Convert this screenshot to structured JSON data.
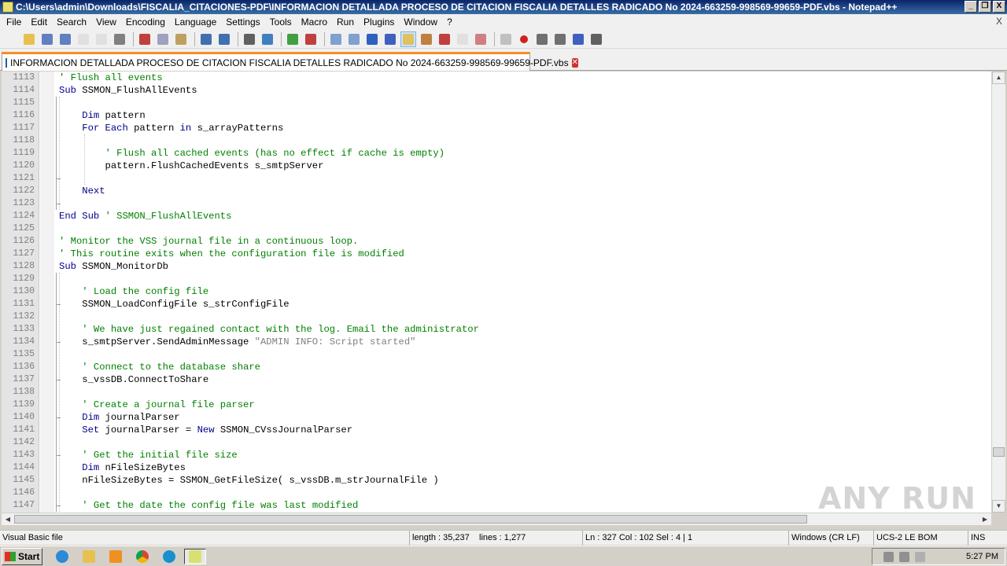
{
  "window": {
    "title": "C:\\Users\\admin\\Downloads\\FISCALIA_CITACIONES-PDF\\INFORMACION DETALLADA PROCESO DE CITACION FISCALIA DETALLES RADICADO No 2024-663259-998569-99659-PDF.vbs - Notepad++",
    "minimize": "_",
    "restore": "❐",
    "close": "X"
  },
  "menu": {
    "items": [
      "File",
      "Edit",
      "Search",
      "View",
      "Encoding",
      "Language",
      "Settings",
      "Tools",
      "Macro",
      "Run",
      "Plugins",
      "Window",
      "?"
    ],
    "close_glyph": "X"
  },
  "toolbar": {
    "icons": [
      "new-file-icon",
      "open-file-icon",
      "save-icon",
      "save-all-icon",
      "close-icon",
      "close-all-icon",
      "print-icon",
      "cut-icon",
      "copy-icon",
      "paste-icon",
      "undo-icon",
      "redo-icon",
      "find-icon",
      "replace-icon",
      "zoom-in-icon",
      "zoom-out-icon",
      "sync-vertical-icon",
      "sync-horizontal-icon",
      "word-wrap-icon",
      "show-all-chars-icon",
      "indent-guide-icon",
      "user-lang-icon",
      "doc-map-icon",
      "function-list-icon",
      "folder-workspace-icon",
      "monitoring-icon",
      "record-macro-icon",
      "stop-macro-icon",
      "play-macro-icon",
      "run-macro-multiple-icon",
      "save-macro-icon"
    ]
  },
  "tab": {
    "label": "INFORMACION DETALLADA PROCESO DE CITACION FISCALIA DETALLES RADICADO No 2024-663259-998569-99659-PDF.vbs",
    "close_glyph": "✕"
  },
  "editor": {
    "lines": [
      {
        "n": "1113",
        "segments": [
          {
            "t": "' Flush all events",
            "c": "cm"
          }
        ]
      },
      {
        "n": "1114",
        "segments": [
          {
            "t": "Sub",
            "c": "kw"
          },
          {
            "t": " SSMON_FlushAllEvents",
            "c": "tx"
          }
        ]
      },
      {
        "n": "1115",
        "segments": []
      },
      {
        "n": "1116",
        "segments": [
          {
            "t": "    ",
            "c": "tx"
          },
          {
            "t": "Dim",
            "c": "kw"
          },
          {
            "t": " pattern",
            "c": "tx"
          }
        ]
      },
      {
        "n": "1117",
        "segments": [
          {
            "t": "    ",
            "c": "tx"
          },
          {
            "t": "For Each",
            "c": "kw"
          },
          {
            "t": " pattern ",
            "c": "tx"
          },
          {
            "t": "in",
            "c": "kw"
          },
          {
            "t": " s_arrayPatterns",
            "c": "tx"
          }
        ]
      },
      {
        "n": "1118",
        "segments": []
      },
      {
        "n": "1119",
        "segments": [
          {
            "t": "        ",
            "c": "tx"
          },
          {
            "t": "' Flush all cached events (has no effect if cache is empty)",
            "c": "cm"
          }
        ]
      },
      {
        "n": "1120",
        "segments": [
          {
            "t": "        pattern.FlushCachedEvents s_smtpServer",
            "c": "tx"
          }
        ]
      },
      {
        "n": "1121",
        "segments": []
      },
      {
        "n": "1122",
        "segments": [
          {
            "t": "    ",
            "c": "tx"
          },
          {
            "t": "Next",
            "c": "kw"
          }
        ]
      },
      {
        "n": "1123",
        "segments": []
      },
      {
        "n": "1124",
        "segments": [
          {
            "t": "End Sub",
            "c": "kw"
          },
          {
            "t": " ",
            "c": "tx"
          },
          {
            "t": "' SSMON_FlushAllEvents",
            "c": "cm"
          }
        ]
      },
      {
        "n": "1125",
        "segments": []
      },
      {
        "n": "1126",
        "segments": [
          {
            "t": "' Monitor the VSS journal file in a continuous loop.",
            "c": "cm"
          }
        ]
      },
      {
        "n": "1127",
        "segments": [
          {
            "t": "' This routine exits when the configuration file is modified",
            "c": "cm"
          }
        ]
      },
      {
        "n": "1128",
        "segments": [
          {
            "t": "Sub",
            "c": "kw"
          },
          {
            "t": " SSMON_MonitorDb",
            "c": "tx"
          }
        ]
      },
      {
        "n": "1129",
        "segments": []
      },
      {
        "n": "1130",
        "segments": [
          {
            "t": "    ",
            "c": "tx"
          },
          {
            "t": "' Load the config file",
            "c": "cm"
          }
        ]
      },
      {
        "n": "1131",
        "segments": [
          {
            "t": "    SSMON_LoadConfigFile s_strConfigFile",
            "c": "tx"
          }
        ]
      },
      {
        "n": "1132",
        "segments": []
      },
      {
        "n": "1133",
        "segments": [
          {
            "t": "    ",
            "c": "tx"
          },
          {
            "t": "' We have just regained contact with the log. Email the administrator",
            "c": "cm"
          }
        ]
      },
      {
        "n": "1134",
        "segments": [
          {
            "t": "    s_smtpServer.SendAdminMessage ",
            "c": "tx"
          },
          {
            "t": "\"ADMIN INFO: Script started\"",
            "c": "st"
          }
        ]
      },
      {
        "n": "1135",
        "segments": []
      },
      {
        "n": "1136",
        "segments": [
          {
            "t": "    ",
            "c": "tx"
          },
          {
            "t": "' Connect to the database share",
            "c": "cm"
          }
        ]
      },
      {
        "n": "1137",
        "segments": [
          {
            "t": "    s_vssDB.ConnectToShare",
            "c": "tx"
          }
        ]
      },
      {
        "n": "1138",
        "segments": []
      },
      {
        "n": "1139",
        "segments": [
          {
            "t": "    ",
            "c": "tx"
          },
          {
            "t": "' Create a journal file parser",
            "c": "cm"
          }
        ]
      },
      {
        "n": "1140",
        "segments": [
          {
            "t": "    ",
            "c": "tx"
          },
          {
            "t": "Dim",
            "c": "kw"
          },
          {
            "t": " journalParser",
            "c": "tx"
          }
        ]
      },
      {
        "n": "1141",
        "segments": [
          {
            "t": "    ",
            "c": "tx"
          },
          {
            "t": "Set",
            "c": "kw"
          },
          {
            "t": " journalParser = ",
            "c": "tx"
          },
          {
            "t": "New",
            "c": "kw"
          },
          {
            "t": " SSMON_CVssJournalParser",
            "c": "tx"
          }
        ]
      },
      {
        "n": "1142",
        "segments": []
      },
      {
        "n": "1143",
        "segments": [
          {
            "t": "    ",
            "c": "tx"
          },
          {
            "t": "' Get the initial file size",
            "c": "cm"
          }
        ]
      },
      {
        "n": "1144",
        "segments": [
          {
            "t": "    ",
            "c": "tx"
          },
          {
            "t": "Dim",
            "c": "kw"
          },
          {
            "t": " nFileSizeBytes",
            "c": "tx"
          }
        ]
      },
      {
        "n": "1145",
        "segments": [
          {
            "t": "    nFileSizeBytes = SSMON_GetFileSize( s_vssDB.m_strJournalFile )",
            "c": "tx"
          }
        ]
      },
      {
        "n": "1146",
        "segments": []
      },
      {
        "n": "1147",
        "segments": [
          {
            "t": "    ",
            "c": "tx"
          },
          {
            "t": "' Get the date the config file was last modified",
            "c": "cm"
          }
        ]
      }
    ]
  },
  "statusbar": {
    "file_type": "Visual Basic file",
    "length": "length : 35,237",
    "lines": "lines : 1,277",
    "position": "Ln : 327    Col : 102    Sel : 4 | 1",
    "eol": "Windows (CR LF)",
    "encoding": "UCS-2 LE BOM",
    "mode": "INS"
  },
  "taskbar": {
    "start_label": "Start",
    "clock": "5:27 PM"
  },
  "watermark": "ANY RUN",
  "colors": {
    "keyword": "#00008b",
    "comment": "#008000",
    "string": "#808080",
    "tab_accent": "#fa8c22"
  }
}
